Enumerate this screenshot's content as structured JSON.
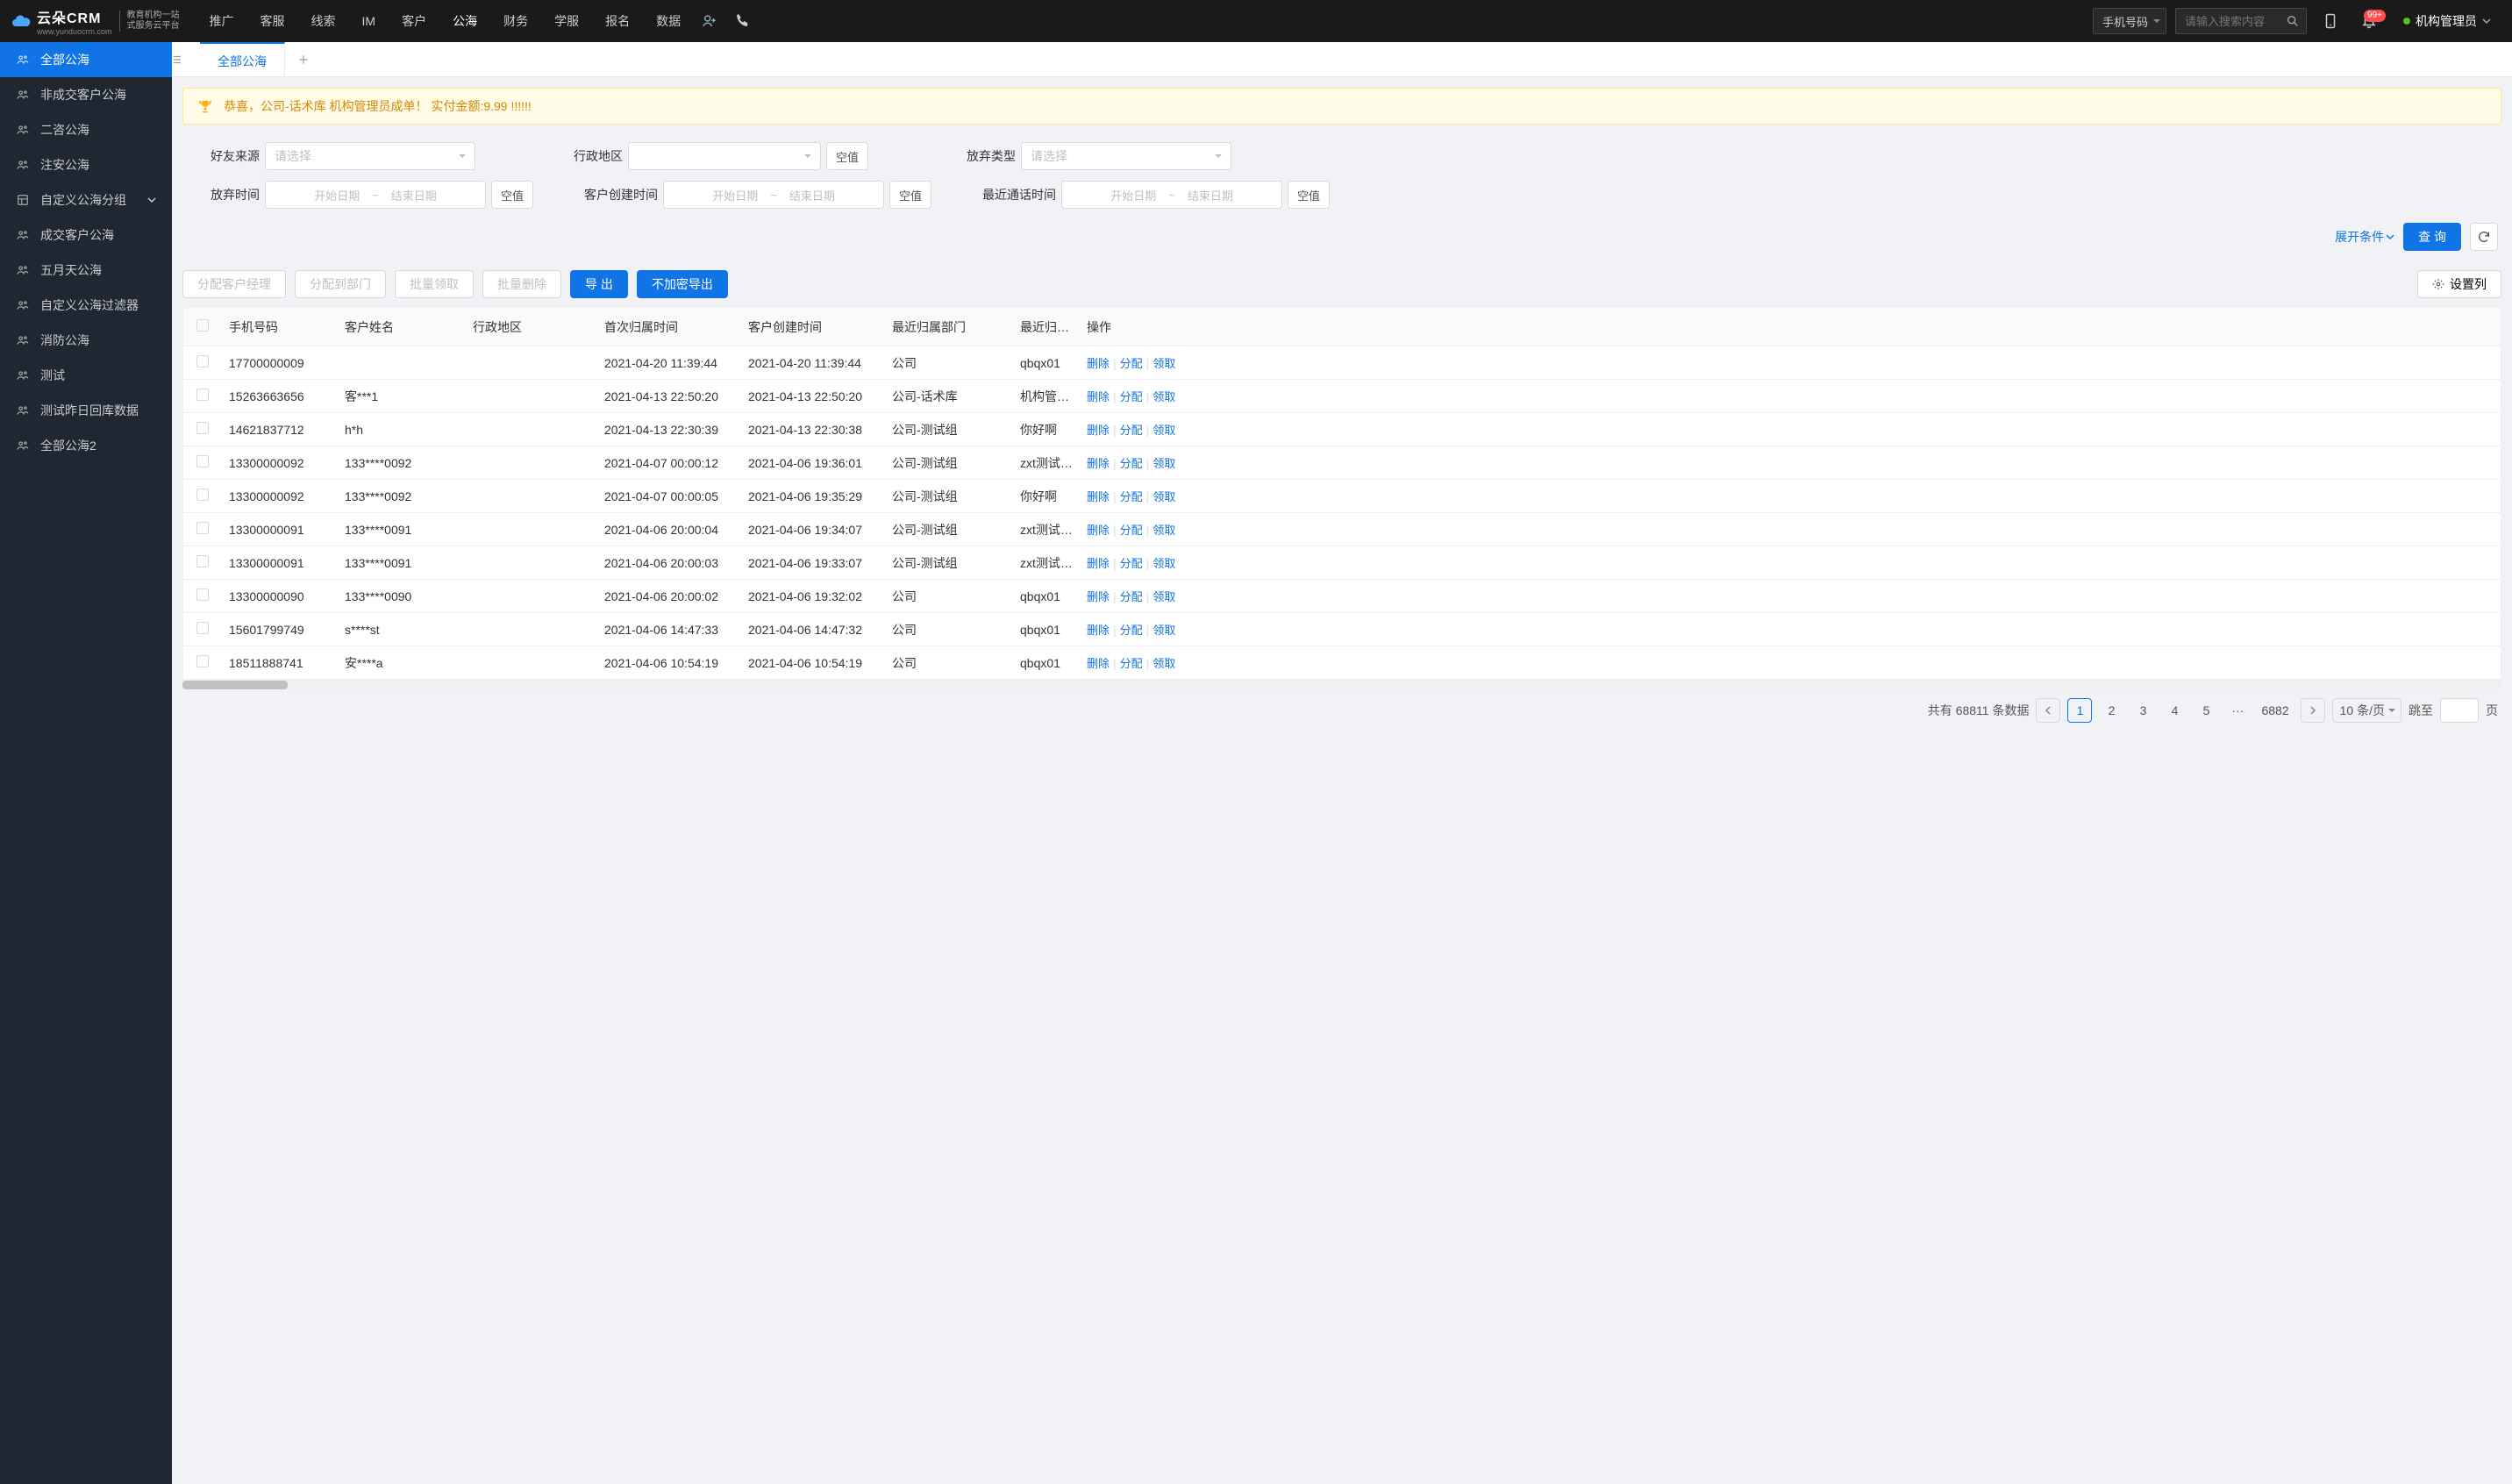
{
  "header": {
    "logo_main": "云朵CRM",
    "logo_sub1": "教育机构一站",
    "logo_sub2": "式服务云平台",
    "logo_domain": "www.yunduocrm.com",
    "nav": [
      "推广",
      "客服",
      "线索",
      "IM",
      "客户",
      "公海",
      "财务",
      "学服",
      "报名",
      "数据"
    ],
    "nav_active_index": 5,
    "search_type": "手机号码",
    "search_placeholder": "请输入搜索内容",
    "notify_badge": "99+",
    "user_name": "机构管理员"
  },
  "sidebar": {
    "items": [
      {
        "label": "全部公海",
        "icon": "users",
        "active": true
      },
      {
        "label": "非成交客户公海",
        "icon": "users"
      },
      {
        "label": "二咨公海",
        "icon": "users"
      },
      {
        "label": "注安公海",
        "icon": "users"
      },
      {
        "label": "自定义公海分组",
        "icon": "layout",
        "caret": true
      },
      {
        "label": "成交客户公海",
        "icon": "users"
      },
      {
        "label": "五月天公海",
        "icon": "users"
      },
      {
        "label": "自定义公海过滤器",
        "icon": "users"
      },
      {
        "label": "消防公海",
        "icon": "users"
      },
      {
        "label": "测试",
        "icon": "users"
      },
      {
        "label": "测试昨日回库数据",
        "icon": "users"
      },
      {
        "label": "全部公海2",
        "icon": "users"
      }
    ]
  },
  "tabs": {
    "items": [
      "全部公海"
    ],
    "active_index": 0
  },
  "banner": "恭喜，公司-话术库  机构管理员成单！  实付金额:9.99 !!!!!!",
  "filters": {
    "row1": [
      {
        "label": "好友来源",
        "type": "select",
        "placeholder": "请选择"
      },
      {
        "label": "行政地区",
        "type": "select",
        "placeholder": "",
        "empty_btn": "空值"
      },
      {
        "label": "放弃类型",
        "type": "select",
        "placeholder": "请选择"
      }
    ],
    "row2": [
      {
        "label": "放弃时间",
        "type": "daterange",
        "start": "开始日期",
        "end": "结束日期",
        "empty_btn": "空值"
      },
      {
        "label": "客户创建时间",
        "type": "daterange",
        "start": "开始日期",
        "end": "结束日期",
        "empty_btn": "空值"
      },
      {
        "label": "最近通话时间",
        "type": "daterange",
        "start": "开始日期",
        "end": "结束日期",
        "empty_btn": "空值"
      }
    ],
    "expand_label": "展开条件",
    "query_label": "查 询"
  },
  "toolbar": {
    "assign_manager": "分配客户经理",
    "assign_dept": "分配到部门",
    "batch_claim": "批量领取",
    "batch_delete": "批量删除",
    "export": "导 出",
    "export_plain": "不加密导出",
    "settings_col": "设置列"
  },
  "table": {
    "columns": [
      "手机号码",
      "客户姓名",
      "行政地区",
      "首次归属时间",
      "客户创建时间",
      "最近归属部门",
      "最近归属人",
      "操作"
    ],
    "actions": {
      "delete": "删除",
      "assign": "分配",
      "claim": "领取"
    },
    "rows": [
      {
        "phone": "17700000009",
        "name": "",
        "region": "",
        "first_time": "2021-04-20 11:39:44",
        "create_time": "2021-04-20 11:39:44",
        "dept": "公司",
        "person": "qbqx01"
      },
      {
        "phone": "15263663656",
        "name": "客***1",
        "region": "",
        "first_time": "2021-04-13 22:50:20",
        "create_time": "2021-04-13 22:50:20",
        "dept": "公司-话术库",
        "person": "机构管理员"
      },
      {
        "phone": "14621837712",
        "name": "h*h",
        "region": "",
        "first_time": "2021-04-13 22:30:39",
        "create_time": "2021-04-13 22:30:38",
        "dept": "公司-测试组",
        "person": "你好啊"
      },
      {
        "phone": "13300000092",
        "name": "133****0092",
        "region": "",
        "first_time": "2021-04-07 00:00:12",
        "create_time": "2021-04-06 19:36:01",
        "dept": "公司-测试组",
        "person": "zxt测试导入"
      },
      {
        "phone": "13300000092",
        "name": "133****0092",
        "region": "",
        "first_time": "2021-04-07 00:00:05",
        "create_time": "2021-04-06 19:35:29",
        "dept": "公司-测试组",
        "person": "你好啊"
      },
      {
        "phone": "13300000091",
        "name": "133****0091",
        "region": "",
        "first_time": "2021-04-06 20:00:04",
        "create_time": "2021-04-06 19:34:07",
        "dept": "公司-测试组",
        "person": "zxt测试导入"
      },
      {
        "phone": "13300000091",
        "name": "133****0091",
        "region": "",
        "first_time": "2021-04-06 20:00:03",
        "create_time": "2021-04-06 19:33:07",
        "dept": "公司-测试组",
        "person": "zxt测试导入"
      },
      {
        "phone": "13300000090",
        "name": "133****0090",
        "region": "",
        "first_time": "2021-04-06 20:00:02",
        "create_time": "2021-04-06 19:32:02",
        "dept": "公司",
        "person": "qbqx01"
      },
      {
        "phone": "15601799749",
        "name": "s****st",
        "region": "",
        "first_time": "2021-04-06 14:47:33",
        "create_time": "2021-04-06 14:47:32",
        "dept": "公司",
        "person": "qbqx01"
      },
      {
        "phone": "18511888741",
        "name": "安****a",
        "region": "",
        "first_time": "2021-04-06 10:54:19",
        "create_time": "2021-04-06 10:54:19",
        "dept": "公司",
        "person": "qbqx01"
      }
    ]
  },
  "pagination": {
    "total_label_prefix": "共有",
    "total": "68811",
    "total_label_suffix": "条数据",
    "pages": [
      "1",
      "2",
      "3",
      "4",
      "5"
    ],
    "ellipsis": "···",
    "last_page": "6882",
    "per_page_label": "10 条/页",
    "jump_label": "跳至",
    "jump_suffix": "页"
  }
}
